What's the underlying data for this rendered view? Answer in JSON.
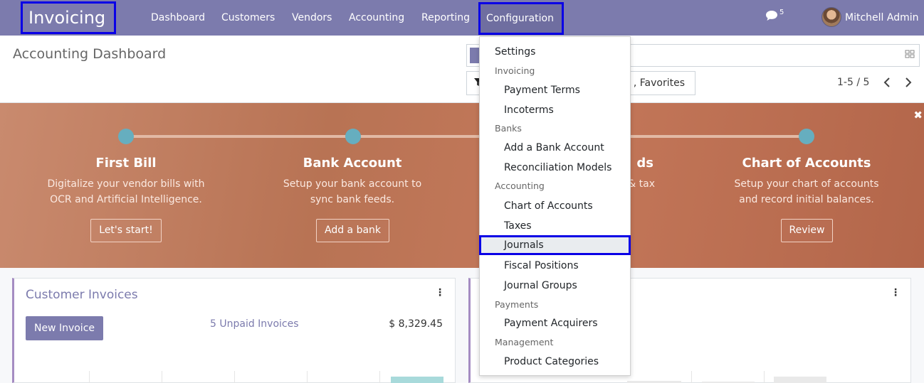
{
  "navbar": {
    "app_name": "Invoicing",
    "menu": [
      "Dashboard",
      "Customers",
      "Vendors",
      "Accounting",
      "Reporting"
    ],
    "config_label": "Configuration",
    "chat_count": "5",
    "user_name": "Mitchell Admin"
  },
  "control_panel": {
    "title": "Accounting Dashboard",
    "filters_label": ", Favorites",
    "pager": "1-5 / 5"
  },
  "banner": {
    "steps": [
      {
        "title": "First Bill",
        "desc1": "Digitalize your vendor bills with",
        "desc2": "OCR and Artificial Intelligence.",
        "button": "Let's start!"
      },
      {
        "title": "Bank Account",
        "desc1": "Setup your bank account to",
        "desc2": "sync bank feeds.",
        "button": "Add a bank"
      },
      {
        "title": "ds",
        "desc1": "& tax",
        "desc2": "",
        "button": ""
      },
      {
        "title": "Chart of Accounts",
        "desc1": "Setup your chart of accounts",
        "desc2": "and record initial balances.",
        "button": "Review"
      }
    ],
    "close_glyph": "✖"
  },
  "cards": {
    "customer_invoices": {
      "title": "Customer Invoices",
      "new_button": "New Invoice",
      "unpaid_link": "5 Unpaid Invoices",
      "unpaid_amount": "$ 8,329.45"
    }
  },
  "dropdown": {
    "settings": "Settings",
    "invoicing_header": "Invoicing",
    "payment_terms": "Payment Terms",
    "incoterms": "Incoterms",
    "banks_header": "Banks",
    "add_bank_account": "Add a Bank Account",
    "reconciliation_models": "Reconciliation Models",
    "accounting_header": "Accounting",
    "chart_of_accounts": "Chart of Accounts",
    "taxes": "Taxes",
    "journals": "Journals",
    "fiscal_positions": "Fiscal Positions",
    "journal_groups": "Journal Groups",
    "payments_header": "Payments",
    "payment_acquirers": "Payment Acquirers",
    "management_header": "Management",
    "product_categories": "Product Categories"
  },
  "colors": {
    "brand": "#7c7bad",
    "highlight_border": "#0a00e6",
    "step_dot": "#66aebf"
  },
  "icons": {
    "chat": "chat-icon",
    "filter": "filter-icon",
    "pager_prev": "chevron-left-icon",
    "pager_next": "chevron-right-icon",
    "card_menu": "kebab-menu-icon",
    "search_toggle": "search-options-icon"
  }
}
